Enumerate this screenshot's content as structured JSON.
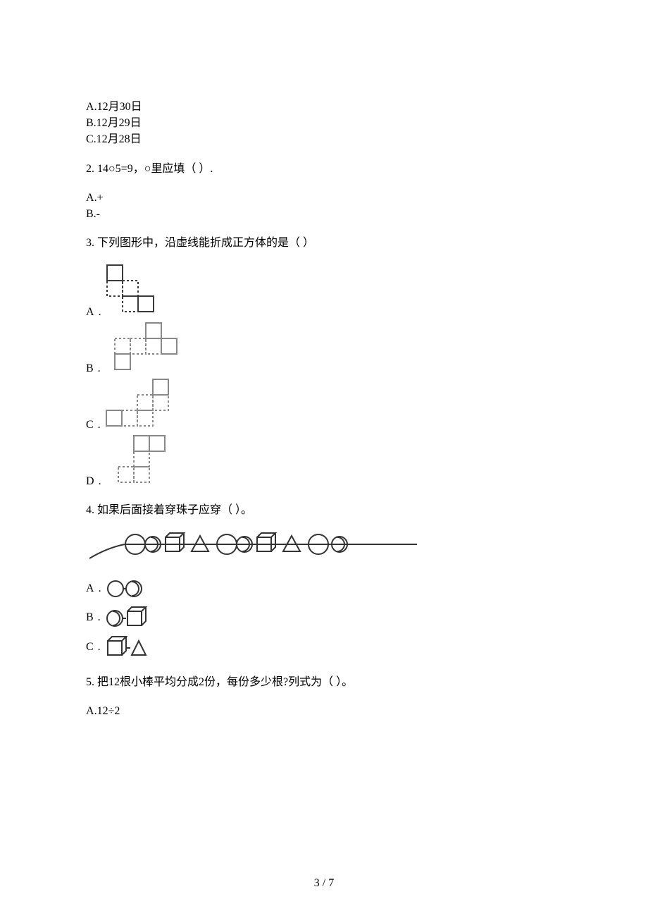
{
  "q1": {
    "optA_label": "A",
    "optA_text": ".12月30日",
    "optB_label": "B",
    "optB_text": ".12月29日",
    "optC_label": "C",
    "optC_text": ".12月28日"
  },
  "q2": {
    "num": "2.",
    "stem": "14○5=9，○里应填（  ）.",
    "optA_label": "A",
    "optA_text": ".+",
    "optB_label": "B",
    "optB_text": ".-"
  },
  "q3": {
    "num": "3.",
    "stem": "下列图形中，沿虚线能折成正方体的是（   ）",
    "optA_label": "A",
    "optA_dot": ".",
    "optB_label": "B",
    "optB_dot": ".",
    "optC_label": "C",
    "optC_dot": ".",
    "optD_label": "D",
    "optD_dot": "."
  },
  "q4": {
    "num": "4.",
    "stem": "如果后面接着穿珠子应穿（   ）。",
    "optA_label": "A",
    "optA_dot": ".",
    "optB_label": "B",
    "optB_dot": ".",
    "optC_label": "C",
    "optC_dot": "."
  },
  "q5": {
    "num": "5.",
    "stem": "把12根小棒平均分成2份，每份多少根?列式为（   ）。",
    "optA_label": "A",
    "optA_text": ".12÷2"
  },
  "footer": "3 / 7"
}
